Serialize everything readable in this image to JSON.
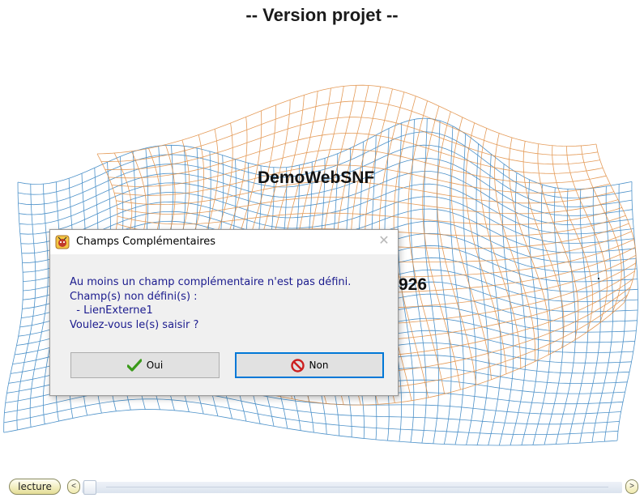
{
  "page": {
    "title": "-- Version projet --"
  },
  "background": {
    "app_name": "DemoWebSNF",
    "version_fragment": "926",
    "colors": {
      "grid_blue": "#2f7fc0",
      "grid_orange": "#e08a3c"
    }
  },
  "dialog": {
    "title": "Champs Complémentaires",
    "app_icon": "app-bug-icon",
    "close_glyph": "✕",
    "message": [
      "Au moins un champ complémentaire n'est pas défini.",
      "Champ(s) non défini(s) :",
      "  - LienExterne1",
      "Voulez-vous le(s) saisir ?"
    ],
    "buttons": {
      "oui": {
        "label": "Oui",
        "icon": "check-icon",
        "color": "#3a9a1a"
      },
      "non": {
        "label": "Non",
        "icon": "no-entry-icon",
        "color": "#cc1f1f"
      }
    },
    "text_color": "#1b1b8e"
  },
  "bottom_bar": {
    "lecture_label": "lecture",
    "prev_glyph": "<",
    "next_glyph": ">"
  }
}
